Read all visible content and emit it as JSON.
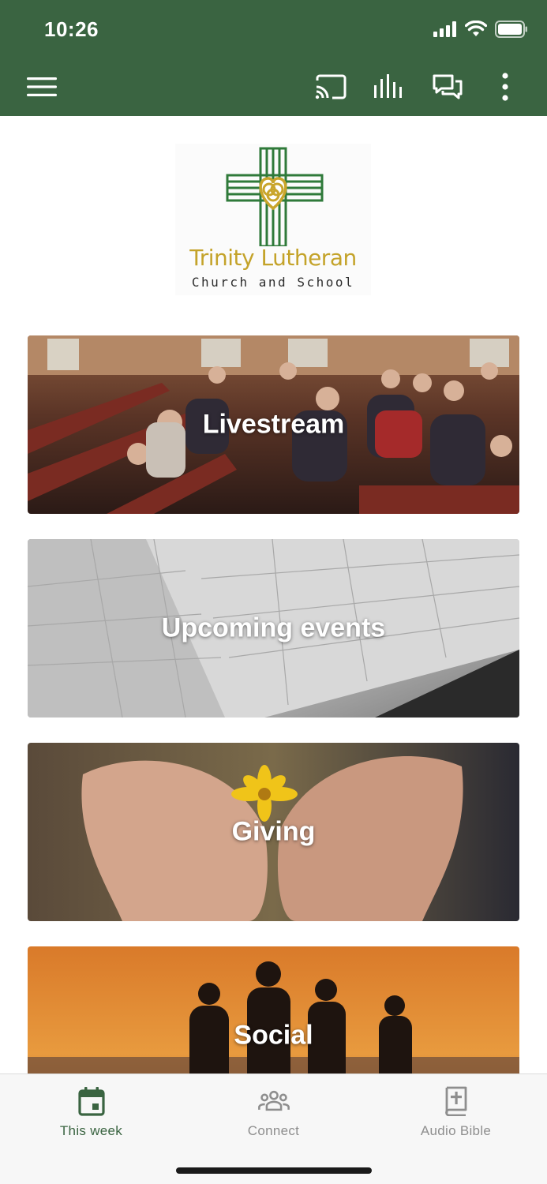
{
  "status_bar": {
    "time": "10:26"
  },
  "colors": {
    "header": "#3a6441",
    "tab_active": "#3a6441",
    "tab_inactive": "#8e8e8e"
  },
  "toolbar": {
    "menu_icon": "hamburger-menu-icon",
    "cast_icon": "cast-icon",
    "audio_icon": "audio-bars-icon",
    "chat_icon": "chat-bubbles-icon",
    "more_icon": "more-vertical-icon"
  },
  "logo": {
    "title": "Trinity Lutheran",
    "subtitle": "Church and School"
  },
  "cards": [
    {
      "label": "Livestream"
    },
    {
      "label": "Upcoming events"
    },
    {
      "label": "Giving"
    },
    {
      "label": "Social"
    }
  ],
  "tabs": [
    {
      "label": "This week",
      "icon": "calendar-icon",
      "active": true
    },
    {
      "label": "Connect",
      "icon": "people-icon",
      "active": false
    },
    {
      "label": "Audio Bible",
      "icon": "bible-icon",
      "active": false
    }
  ]
}
